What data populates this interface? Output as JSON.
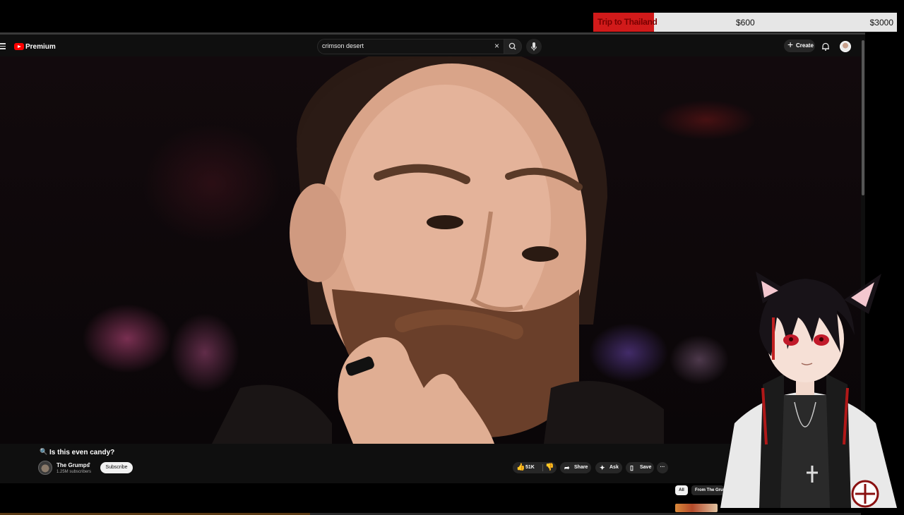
{
  "goal": {
    "name": "Trip to Thailand",
    "current": "$600",
    "target": "$3000",
    "progress_fraction": 0.2,
    "fill_color": "#d11a1a"
  },
  "youtube": {
    "brand": "Premium",
    "search": {
      "query": "crimson desert",
      "clear_icon": "close-icon",
      "search_icon": "search-icon",
      "mic_icon": "microphone-icon"
    },
    "create_label": "Create",
    "notifications_icon": "bell-icon"
  },
  "video": {
    "title_icon": "🔍",
    "title": "Is this even candy?",
    "channel": "The Grumps",
    "subscribers": "1.25M subscribers",
    "subscribe_label": "Subscribe",
    "likes": "51K",
    "share_label": "Share",
    "ask_label": "Ask",
    "save_label": "Save",
    "progress_fraction": 0.36
  },
  "related": {
    "chips": [
      "All",
      "From The Grumps"
    ]
  },
  "colors": {
    "background": "#0f0f0f",
    "accent_red": "#ff0000"
  }
}
